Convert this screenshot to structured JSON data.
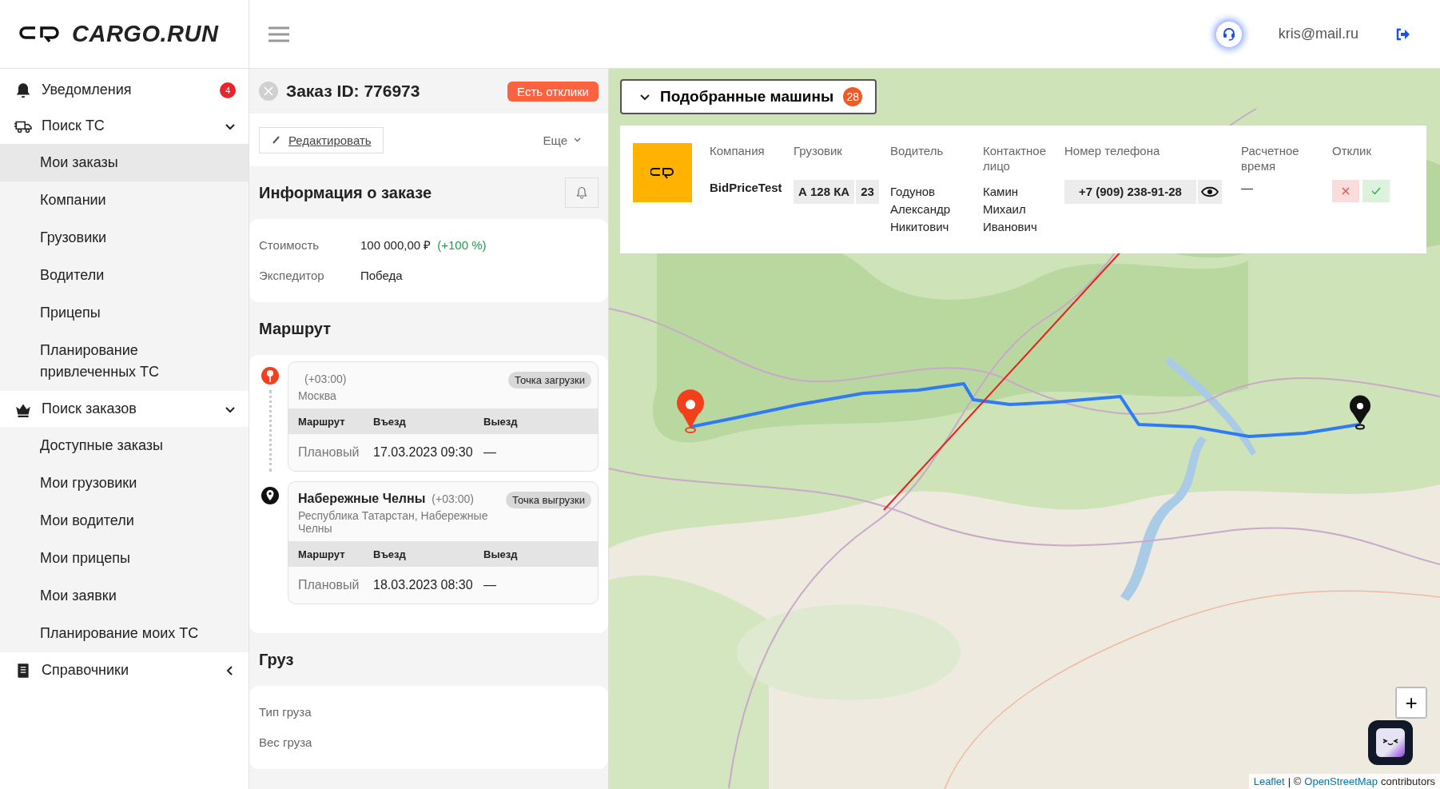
{
  "header": {
    "logo": "CARGO.RUN",
    "user": "kris@mail.ru"
  },
  "sidebar": {
    "items": [
      {
        "kind": "link",
        "label": "Уведомления",
        "badge": "4"
      },
      {
        "kind": "group",
        "label": "Поиск ТС",
        "expanded": true,
        "children": [
          {
            "label": "Мои заказы",
            "selected": true
          },
          {
            "label": "Компании",
            "selected": false
          },
          {
            "label": "Грузовики",
            "selected": false
          },
          {
            "label": "Водители",
            "selected": false
          },
          {
            "label": "Прицепы",
            "selected": false
          },
          {
            "label": "Планирование привлеченных ТС",
            "selected": false
          }
        ]
      },
      {
        "kind": "group",
        "label": "Поиск заказов",
        "expanded": true,
        "children": [
          {
            "label": "Доступные заказы",
            "selected": false
          },
          {
            "label": "Мои грузовики",
            "selected": false
          },
          {
            "label": "Мои водители",
            "selected": false
          },
          {
            "label": "Мои прицепы",
            "selected": false
          },
          {
            "label": "Мои заявки",
            "selected": false
          },
          {
            "label": "Планирование моих ТС",
            "selected": false
          }
        ]
      },
      {
        "kind": "group",
        "label": "Справочники",
        "expanded": false
      }
    ]
  },
  "order": {
    "title": "Заказ ID: 776973",
    "status": "Есть отклики",
    "edit": "Редактировать",
    "more": "Еще",
    "info": {
      "title": "Информация о заказе",
      "rows": [
        {
          "label": "Стоимость",
          "value": "100 000,00 ₽",
          "change": "(+100 %)"
        },
        {
          "label": "Экспедитор",
          "value": "Победа"
        }
      ]
    },
    "route": {
      "title": "Маршрут",
      "points": [
        {
          "kind": "loading",
          "tz": "(+03:00)",
          "address": "Москва",
          "tag": "Точка загрузки",
          "columns": [
            "Маршрут",
            "Въезд",
            "Выезд"
          ],
          "row": [
            "Плановый",
            "17.03.2023 09:30",
            "—"
          ]
        },
        {
          "kind": "unloading",
          "city": "Набережные Челны",
          "tz": "(+03:00)",
          "address": "Республика Татарстан, Набережные Челны",
          "tag": "Точка выгрузки",
          "columns": [
            "Маршрут",
            "Въезд",
            "Выезд"
          ],
          "row": [
            "Плановый",
            "18.03.2023 08:30",
            "—"
          ]
        }
      ]
    },
    "cargo": {
      "title": "Груз",
      "rows": [
        {
          "label": "Тип груза"
        },
        {
          "label": "Вес груза"
        }
      ]
    }
  },
  "map": {
    "matched": {
      "label": "Подобранные машины",
      "count": "28",
      "expanded": true
    },
    "table": {
      "columns": [
        "Компания",
        "Грузовик",
        "Водитель",
        "Контактное лицо",
        "Номер телефона",
        "Расчетное время",
        "Отклик"
      ],
      "rows": [
        {
          "company": "BidPriceTest",
          "plate": "А 128 КА",
          "region": "23",
          "driver": "Годунов Александр Никитович",
          "contact": "Камин Михаил Иванович",
          "phone": "+7 (909) 238-91-28",
          "eta": "—"
        }
      ]
    },
    "zoom": [
      "+"
    ],
    "attribution": {
      "leaflet": "Leaflet",
      "middle": "| ©",
      "osm": "OpenStreetMap",
      "tail": "contributors"
    }
  }
}
